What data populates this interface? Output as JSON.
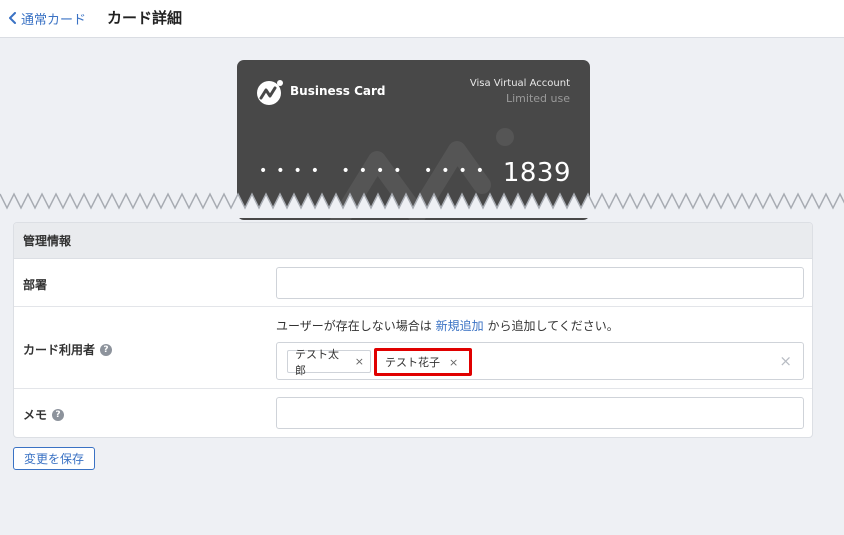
{
  "header": {
    "back_label": "通常カード",
    "title": "カード詳細"
  },
  "card": {
    "brand": "Business Card",
    "type": "Visa Virtual Account",
    "limit": "Limited use",
    "masked": "•••• •••• ••••",
    "last4": "1839"
  },
  "panel": {
    "title": "管理情報",
    "department": {
      "label": "部署",
      "value": ""
    },
    "card_user": {
      "label": "カード利用者",
      "hint_before": "ユーザーが存在しない場合は",
      "hint_link": "新規追加",
      "hint_after": "から追加してください。",
      "tags": [
        "テスト太郎",
        "テスト花子"
      ],
      "remove_symbol": "×",
      "clear_symbol": "×"
    },
    "memo": {
      "label": "メモ",
      "value": ""
    },
    "help_symbol": "?"
  },
  "save_label": "変更を保存",
  "colors": {
    "accent": "#3a72c4",
    "card_bg": "#484848",
    "highlight": "#e00000",
    "page_bg": "#eef0f4"
  },
  "icons": {
    "back": "chevron-left-icon",
    "logo": "moneyforward-logo-icon",
    "help": "question-circle-icon",
    "remove": "close-icon"
  }
}
